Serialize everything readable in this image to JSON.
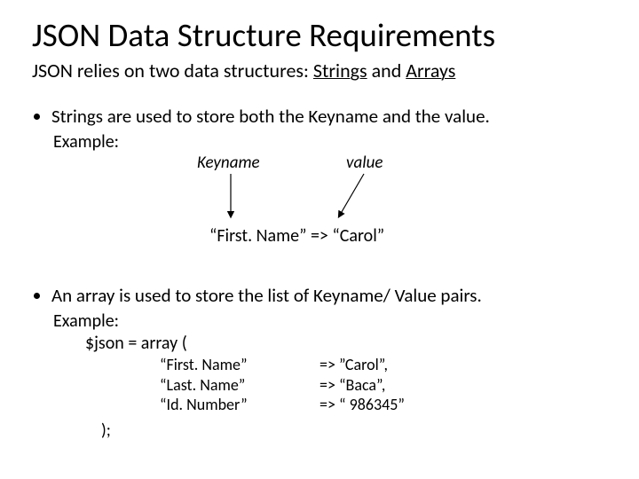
{
  "title": "JSON Data Structure Requirements",
  "subtitle_prefix": "JSON relies on two data structures: ",
  "subtitle_word1": "Strings",
  "subtitle_and": " and ",
  "subtitle_word2": "Arrays",
  "bullet1": "Strings are used to store both the Keyname and the value.",
  "example_label": "Example:",
  "keyname_label": "Keyname",
  "value_label": "value",
  "example_kv": "“First. Name” => “Carol”",
  "bullet2": "An array is used to store the list of Keyname/ Value pairs.",
  "array_open": "$json = array (",
  "pairs": {
    "k0": "“First. Name”",
    "v0": "=> ”Carol”,",
    "k1": "“Last. Name”",
    "v1": " => “Baca”,",
    "k2": "“Id. Number”",
    "v2": " => “ 986345”"
  },
  "array_close": ");"
}
